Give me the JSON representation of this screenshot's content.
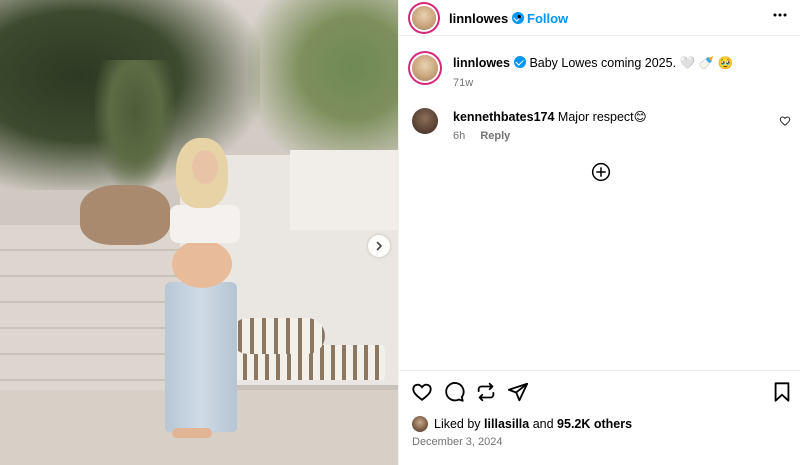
{
  "header": {
    "username": "linnlowes",
    "separator": "•",
    "follow_label": "Follow",
    "more_label": "•••"
  },
  "caption": {
    "username": "linnlowes",
    "text": "Baby Lowes coming 2025. 🤍 🍼 🥹",
    "time": "71w"
  },
  "comments": [
    {
      "username": "kennethbates174",
      "text": "Major respect😊",
      "time": "6h",
      "reply_label": "Reply"
    }
  ],
  "likes": {
    "prefix": "Liked by",
    "user": "lillasilla",
    "connector": "and",
    "count": "95.2K others"
  },
  "date": "December 3, 2024",
  "icons": {
    "like": "heart-icon",
    "comment": "comment-icon",
    "share": "repost-icon",
    "send": "send-icon",
    "save": "bookmark-icon",
    "more": "more-icon",
    "next": "chevron-right-icon",
    "load_more": "plus-circle-icon"
  },
  "colors": {
    "accent": "#0095f6",
    "muted": "#737373",
    "ring": "#d62976"
  }
}
